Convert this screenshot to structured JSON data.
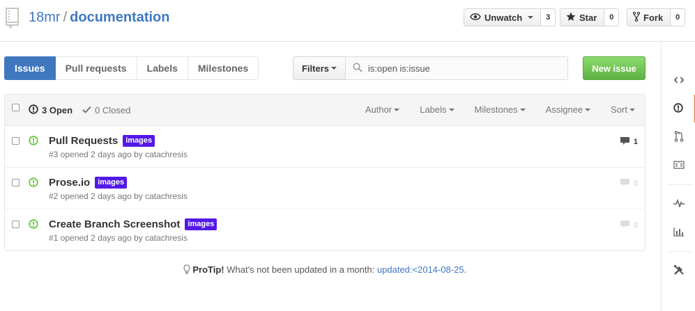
{
  "repo": {
    "owner": "18mr",
    "separator": "/",
    "name": "documentation"
  },
  "actions": {
    "watch": {
      "label": "Unwatch",
      "count": "3",
      "icon": "eye-icon"
    },
    "star": {
      "label": "Star",
      "count": "0",
      "icon": "star-icon"
    },
    "fork": {
      "label": "Fork",
      "count": "0",
      "icon": "fork-icon"
    }
  },
  "subnav": {
    "tabs": [
      {
        "label": "Issues",
        "selected": true
      },
      {
        "label": "Pull requests",
        "selected": false
      },
      {
        "label": "Labels",
        "selected": false
      },
      {
        "label": "Milestones",
        "selected": false
      }
    ],
    "filters_label": "Filters",
    "search_value": "is:open is:issue",
    "new_issue_label": "New issue"
  },
  "issues_header": {
    "open_label": "3 Open",
    "closed_label": "0 Closed",
    "sorts": [
      "Author",
      "Labels",
      "Milestones",
      "Assignee",
      "Sort"
    ]
  },
  "issues": [
    {
      "title": "Pull Requests",
      "label": "images",
      "meta": "#3 opened 2 days ago by",
      "author": "catachresis",
      "comments": "1"
    },
    {
      "title": "Prose.io",
      "label": "images",
      "meta": "#2 opened 2 days ago by",
      "author": "catachresis",
      "comments": "0"
    },
    {
      "title": "Create Branch Screenshot",
      "label": "images",
      "meta": "#1 opened 2 days ago by",
      "author": "catachresis",
      "comments": "0"
    }
  ],
  "protip": {
    "bold": "ProTip!",
    "text": " What's not been updated in a month: ",
    "link": "updated:<2014-08-25",
    "end": "."
  },
  "sidebar": {
    "icons": [
      "code-icon",
      "issue-opened-icon",
      "pull-request-icon",
      "wiki-icon",
      "pulse-icon",
      "graph-icon",
      "settings-icon"
    ]
  },
  "colors": {
    "link": "#4078c0",
    "label_images": "#5319e7",
    "open_green": "#6cc644",
    "new_issue_green": "#60b044",
    "active_tab_orange": "#d26911"
  }
}
